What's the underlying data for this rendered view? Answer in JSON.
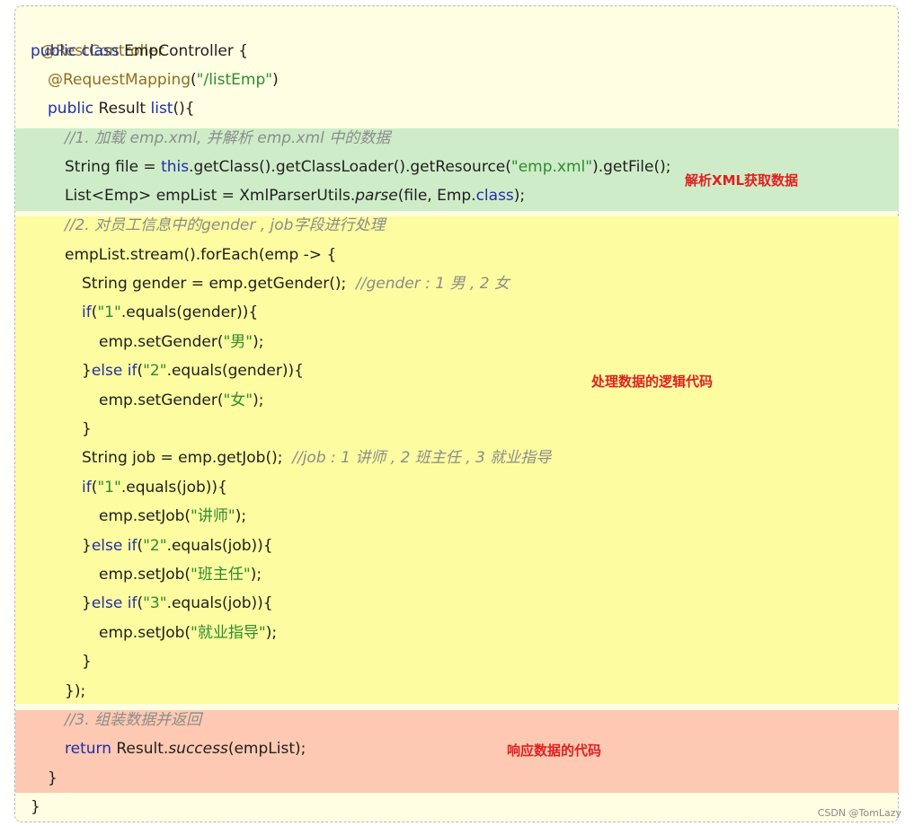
{
  "code": {
    "l1": "@RestController",
    "l2_kw": "public class",
    "l2_rest": " EmpController {",
    "l3_an": "@RequestMapping",
    "l3_p1": "(",
    "l3_str": "\"/listEmp\"",
    "l3_p2": ")",
    "l4_kw": "public",
    "l4_mid": " Result ",
    "l4_fn": "list",
    "l4_end": "(){",
    "l5_cm": "//1. 加载 emp.xml, 并解析 emp.xml 中的数据",
    "l6_a": "String file = ",
    "l6_kw": "this",
    "l6_b": ".getClass().getClassLoader().getResource(",
    "l6_str": "\"emp.xml\"",
    "l6_c": ").getFile();",
    "l7_a": "List<Emp> empList = XmlParserUtils.",
    "l7_it": "parse",
    "l7_b": "(file, Emp.",
    "l7_kw": "class",
    "l7_c": ");",
    "l8_cm": "//2. 对员工信息中的gender , job字段进行处理",
    "l9": "empList.stream().forEach(emp -> {",
    "l10_a": "String gender = emp.getGender();  ",
    "l10_cm": "//gender : 1 男 , 2 女",
    "l11_kw": "if",
    "l11_a": "(",
    "l11_str": "\"1\"",
    "l11_b": ".equals(gender)){",
    "l12_a": "emp.setGender(",
    "l12_str": "\"男\"",
    "l12_b": ");",
    "l13_a": "}",
    "l13_kw1": "else",
    "l13_sp": " ",
    "l13_kw2": "if",
    "l13_b": "(",
    "l13_str": "\"2\"",
    "l13_c": ".equals(gender)){",
    "l14_a": "emp.setGender(",
    "l14_str": "\"女\"",
    "l14_b": ");",
    "l15": "}",
    "l16_a": "String job = emp.getJob();  ",
    "l16_cm": "//job : 1 讲师 , 2 班主任 , 3 就业指导",
    "l17_kw": "if",
    "l17_a": "(",
    "l17_str": "\"1\"",
    "l17_b": ".equals(job)){",
    "l18_a": "emp.setJob(",
    "l18_str": "\"讲师\"",
    "l18_b": ");",
    "l19_a": "}",
    "l19_kw1": "else",
    "l19_sp": " ",
    "l19_kw2": "if",
    "l19_b": "(",
    "l19_str": "\"2\"",
    "l19_c": ".equals(job)){",
    "l20_a": "emp.setJob(",
    "l20_str": "\"班主任\"",
    "l20_b": ");",
    "l21_a": "}",
    "l21_kw1": "else",
    "l21_sp": " ",
    "l21_kw2": "if",
    "l21_b": "(",
    "l21_str": "\"3\"",
    "l21_c": ".equals(job)){",
    "l22_a": "emp.setJob(",
    "l22_str": "\"就业指导\"",
    "l22_b": ");",
    "l23": "}",
    "l24": "});",
    "l25_cm": "//3. 组装数据并返回",
    "l26_kw": "return",
    "l26_a": " Result.",
    "l26_it": "success",
    "l26_b": "(empList);",
    "l27": "}",
    "l28": "}"
  },
  "annotations": {
    "parse": "解析XML获取数据",
    "process": "处理数据的逻辑代码",
    "response": "响应数据的代码"
  },
  "watermark": "CSDN @TomLazy",
  "colors": {
    "code_bg": "#fefee3",
    "green_band": "#ceecc8",
    "yellow_band": "#fdfca0",
    "red_band": "#fdc9b2",
    "keyword": "#1f2fa8",
    "string": "#2e8b2e",
    "annotation": "#8c6f1f",
    "comment": "#8c8c8c",
    "note": "#e02020"
  }
}
